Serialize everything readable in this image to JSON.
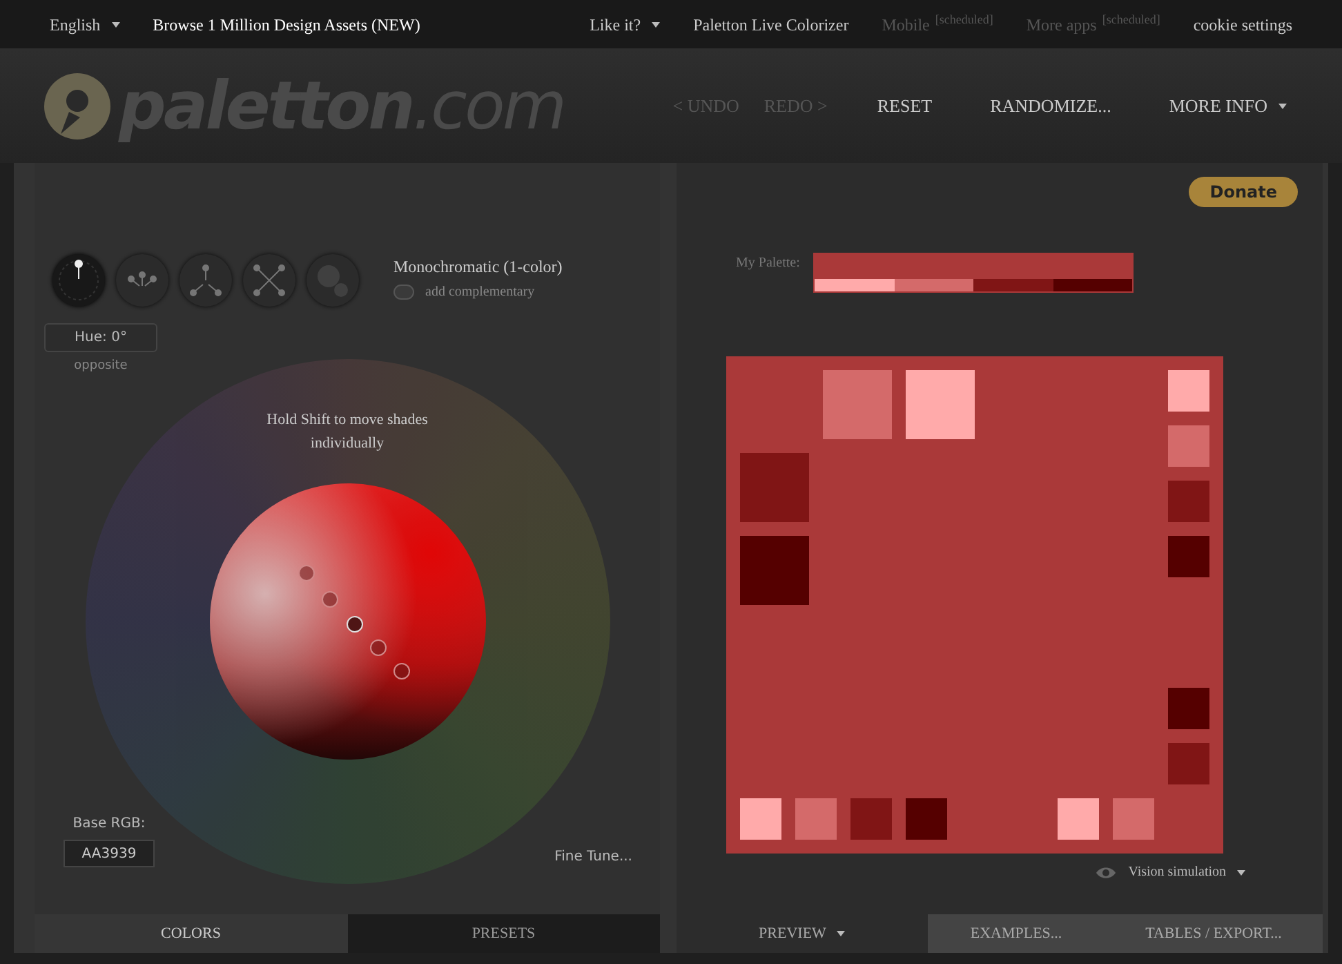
{
  "top_bar": [
    {
      "label": "English",
      "kind": "dropdown",
      "disabled": false
    },
    {
      "label": "Browse 1 Million Design Assets (NEW)",
      "kind": "highlight",
      "disabled": false
    },
    {
      "label": "Like it?",
      "kind": "dropdown",
      "disabled": false
    },
    {
      "label": "Paletton Live Colorizer",
      "kind": "link",
      "disabled": false
    },
    {
      "label": "Mobile",
      "kind": "link",
      "disabled": true,
      "note": "[scheduled]"
    },
    {
      "label": "More apps",
      "kind": "link",
      "disabled": true,
      "note": "[scheduled]"
    },
    {
      "label": "cookie settings",
      "kind": "link",
      "disabled": false
    }
  ],
  "logo": {
    "name": "paletton",
    "suffix": ".com"
  },
  "actions": [
    {
      "label": "< UNDO",
      "disabled": true,
      "dropdown": false
    },
    {
      "label": "REDO >",
      "disabled": true,
      "dropdown": false
    },
    {
      "label": "RESET",
      "disabled": false,
      "dropdown": false
    },
    {
      "label": "RANDOMIZE...",
      "disabled": false,
      "dropdown": false
    },
    {
      "label": "MORE INFO",
      "disabled": false,
      "dropdown": true
    }
  ],
  "scheme_modes": [
    {
      "kind": "mono",
      "selected": true
    },
    {
      "kind": "adjacent",
      "selected": false
    },
    {
      "kind": "triad",
      "selected": false
    },
    {
      "kind": "tetrad",
      "selected": false
    },
    {
      "kind": "free",
      "selected": false
    }
  ],
  "scheme_title": "Monochromatic (1-color)",
  "add_complementary": {
    "label": "add complementary",
    "on": false
  },
  "hue": {
    "value": "Hue: 0°",
    "sublabel": "opposite"
  },
  "wheel_hint": "Hold Shift to move shades individually",
  "base_rgb": {
    "label": "Base RGB:",
    "value": "AA3939"
  },
  "fine_tune": "Fine Tune...",
  "left_tabs": [
    {
      "label": "COLORS",
      "selected": true
    },
    {
      "label": "PRESETS",
      "selected": false
    }
  ],
  "donate": "Donate",
  "palette": {
    "label": "My Palette:",
    "base": {
      "color": "#aa3939"
    },
    "shades": [
      {
        "color": "#ffaaaa"
      },
      {
        "color": "#d46a6a"
      },
      {
        "color": "#801515"
      },
      {
        "color": "#550000"
      }
    ]
  },
  "preview": {
    "color": "#aa3939",
    "swatches": [
      {
        "color": "#d46a6a"
      },
      {
        "color": "#ffaaaa"
      },
      {
        "color": "#801515"
      },
      {
        "color": "#550000"
      },
      {
        "color": "#ffaaaa"
      },
      {
        "color": "#d46a6a"
      },
      {
        "color": "#801515"
      },
      {
        "color": "#550000"
      },
      {
        "color": "#550000"
      },
      {
        "color": "#801515"
      },
      {
        "color": "#ffaaaa"
      },
      {
        "color": "#d46a6a"
      },
      {
        "color": "#801515"
      },
      {
        "color": "#550000"
      },
      {
        "color": "#ffaaaa"
      },
      {
        "color": "#d46a6a"
      }
    ]
  },
  "vision_simulation": "Vision simulation",
  "right_tabs": [
    {
      "label": "PREVIEW",
      "selected": true,
      "dropdown": true
    },
    {
      "label": "EXAMPLES...",
      "selected": false,
      "dropdown": false
    },
    {
      "label": "TABLES / EXPORT...",
      "selected": false,
      "dropdown": false
    }
  ]
}
